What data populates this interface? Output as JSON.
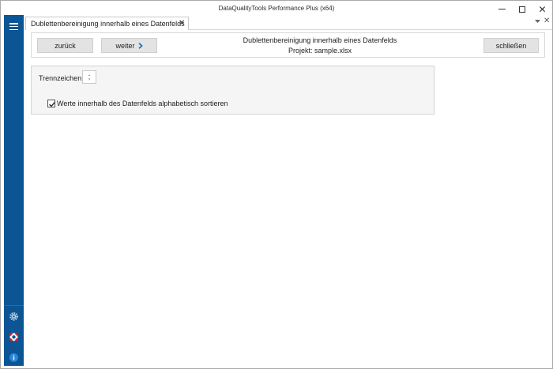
{
  "window": {
    "title": "DataQualityTools Performance Plus (x64)"
  },
  "tab": {
    "label": "Dublettenbereinigung innerhalb eines Datenfelds",
    "close_glyph": "✕"
  },
  "toolbar": {
    "back_label": "zurück",
    "next_label": "weiter",
    "close_label": "schließen",
    "heading": "Dublettenbereinigung innerhalb eines Datenfelds",
    "project": "Projekt: sample.xlsx"
  },
  "options": {
    "separator_label": "Trennzeichen:",
    "separator_value": ";",
    "sort_checkbox_label": "Werte innerhalb des Datenfelds alphabetisch sortieren",
    "sort_checked": true
  },
  "sidebar": {
    "icons": [
      "hamburger-menu-icon",
      "gear-icon",
      "help-lifebuoy-icon",
      "info-icon"
    ]
  },
  "colors": {
    "sidebar": "#0b5595",
    "button": "#e3e3e3",
    "panel": "#f5f5f5",
    "accent": "#1f6fbf"
  }
}
